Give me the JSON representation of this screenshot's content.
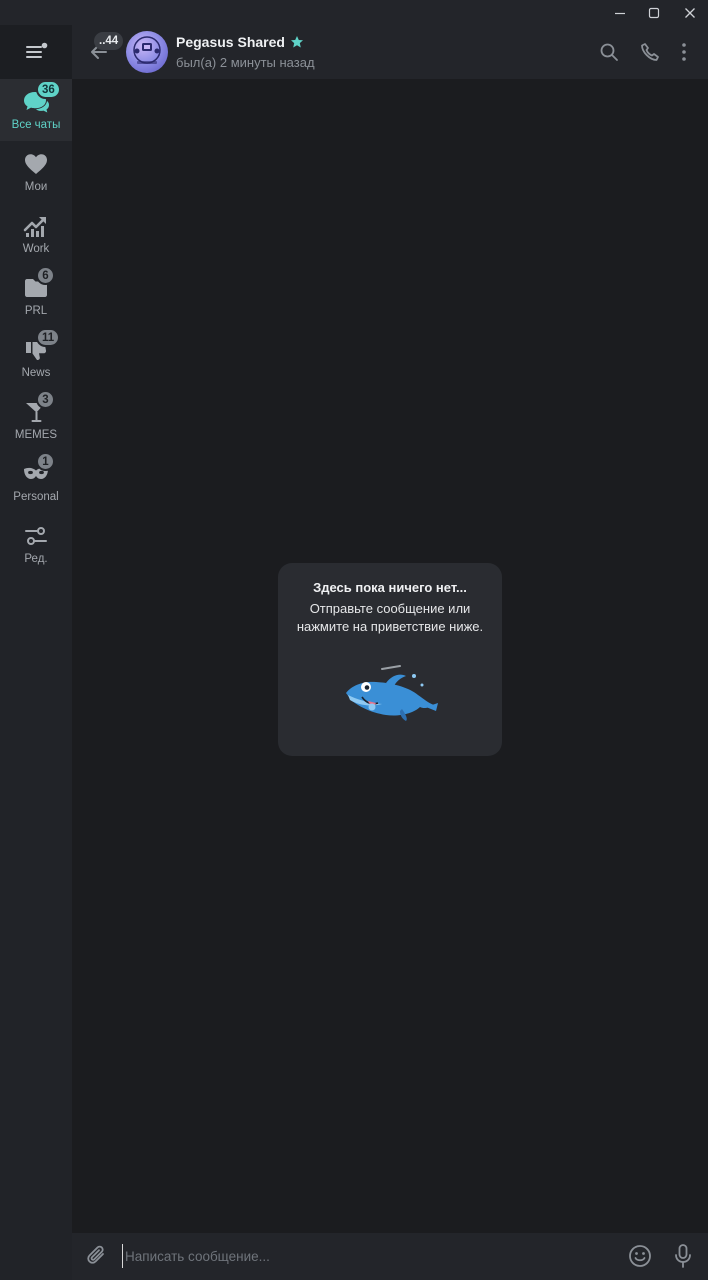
{
  "window": {
    "controls": [
      {
        "icon": "minimize-icon"
      },
      {
        "icon": "maximize-icon"
      },
      {
        "icon": "close-icon"
      }
    ]
  },
  "sidebar": {
    "menu_icon": "hamburger-menu-icon",
    "folders": [
      {
        "label": "Все чаты",
        "badge": "36",
        "icon": "chats-icon",
        "active": true
      },
      {
        "label": "Мои",
        "badge": "",
        "icon": "heart-icon",
        "active": false
      },
      {
        "label": "Work",
        "badge": "",
        "icon": "chart-up-icon",
        "active": false
      },
      {
        "label": "PRL",
        "badge": "6",
        "icon": "folder-icon",
        "active": false
      },
      {
        "label": "News",
        "badge": "11",
        "icon": "thumbs-down-icon",
        "active": false
      },
      {
        "label": "MEMES",
        "badge": "3",
        "icon": "cocktail-icon",
        "active": false
      },
      {
        "label": "Personal",
        "badge": "1",
        "icon": "mask-icon",
        "active": false
      },
      {
        "label": "Ред.",
        "badge": "",
        "icon": "edit-filters-icon",
        "active": false
      }
    ]
  },
  "header": {
    "back_badge": "..44",
    "title": "Pegasus Shared",
    "status": "был(а) 2 минуты назад",
    "star_color": "#5fd3c8",
    "actions": [
      "search-icon",
      "phone-icon",
      "more-vertical-icon"
    ]
  },
  "empty_state": {
    "title": "Здесь пока ничего нет...",
    "description": "Отправьте сообщение или нажмите на приветствие ниже.",
    "sticker": "dolphin-sticker"
  },
  "composer": {
    "placeholder": "Написать сообщение...",
    "icons": [
      "attach-icon",
      "emoji-icon",
      "microphone-icon"
    ]
  },
  "colors": {
    "accent": "#5fd3c8",
    "background": "#1b1c1f",
    "panel": "#23252a"
  }
}
